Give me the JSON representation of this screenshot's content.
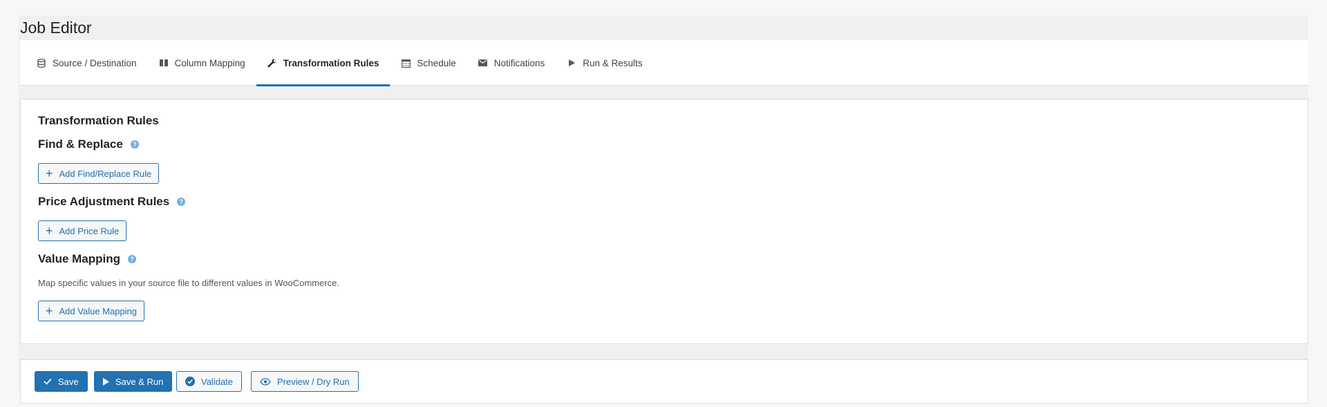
{
  "page": {
    "title": "Job Editor"
  },
  "tabs": [
    {
      "label": "Source / Destination",
      "icon": "database-icon"
    },
    {
      "label": "Column Mapping",
      "icon": "columns-icon"
    },
    {
      "label": "Transformation Rules",
      "icon": "wrench-icon",
      "active": true
    },
    {
      "label": "Schedule",
      "icon": "calendar-icon"
    },
    {
      "label": "Notifications",
      "icon": "envelope-icon"
    },
    {
      "label": "Run & Results",
      "icon": "play-icon"
    }
  ],
  "panel": {
    "title": "Transformation Rules",
    "find_replace": {
      "title": "Find & Replace",
      "button": "Add Find/Replace Rule"
    },
    "price_rules": {
      "title": "Price Adjustment Rules",
      "button": "Add Price Rule"
    },
    "value_mapping": {
      "title": "Value Mapping",
      "description": "Map specific values in your source file to different values in WooCommerce.",
      "button": "Add Value Mapping"
    },
    "help_glyph": "?",
    "plus_glyph": "+"
  },
  "footer": {
    "save": "Save",
    "save_run": "Save & Run",
    "validate": "Validate",
    "preview": "Preview / Dry Run"
  },
  "colors": {
    "accent": "#2271b1",
    "help": "#72aee6"
  }
}
